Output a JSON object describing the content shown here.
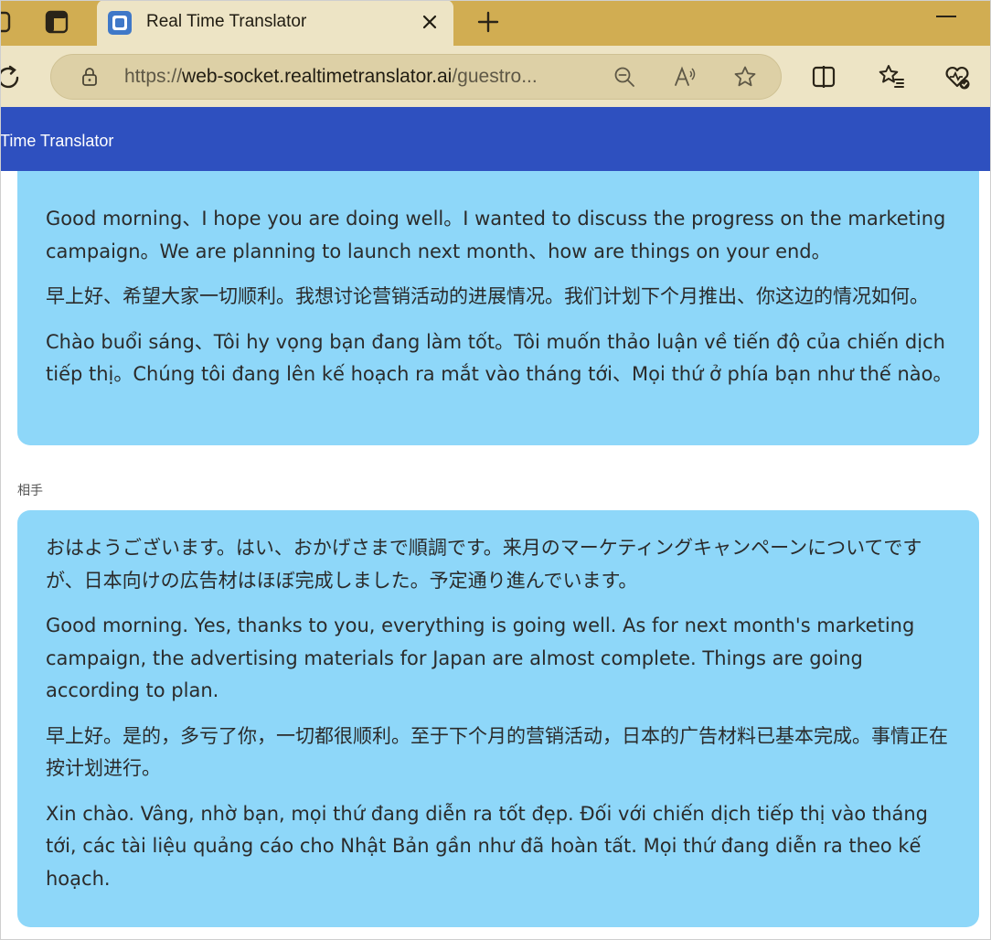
{
  "browser": {
    "tab_title": "Real Time Translator",
    "url_host_prefix": "https://",
    "url_host": "web-socket.realtimetranslator.ai",
    "url_path": "/guestro..."
  },
  "app": {
    "title": "Time Translator"
  },
  "conversation": {
    "first": {
      "paragraphs": [
        "Good morning、I hope you are doing well。I wanted to discuss the progress on the marketing campaign。We are planning to launch next month、how are things on your end。",
        "早上好、希望大家一切顺利。我想讨论营销活动的进展情况。我们计划下个月推出、你这边的情况如何。",
        "Chào buổi sáng、Tôi hy vọng bạn đang làm tốt。Tôi muốn thảo luận về tiến độ của chiến dịch tiếp thị。Chúng tôi đang lên kế hoạch ra mắt vào tháng tới、Mọi thứ ở phía bạn như thế nào。"
      ]
    },
    "second": {
      "speaker": "相手",
      "paragraphs": [
        "おはようございます。はい、おかげさまで順調です。来月のマーケティングキャンペーンについてですが、日本向けの広告材はほぼ完成しました。予定通り進んでいます。",
        "Good morning. Yes, thanks to you, everything is going well. As for next month's marketing campaign, the advertising materials for Japan are almost complete. Things are going according to plan.",
        "早上好。是的，多亏了你，一切都很顺利。至于下个月的营销活动，日本的广告材料已基本完成。事情正在按计划进行。",
        "Xin chào. Vâng, nhờ bạn, mọi thứ đang diễn ra tốt đẹp. Đối với chiến dịch tiếp thị vào tháng tới, các tài liệu quảng cáo cho Nhật Bản gần như đã hoàn tất. Mọi thứ đang diễn ra theo kế hoạch."
      ]
    }
  },
  "colors": {
    "tab_strip": "#d1ad52",
    "toolbar": "#ede4c5",
    "app_bar": "#2e50bf",
    "bubble": "#8ed7f9"
  }
}
